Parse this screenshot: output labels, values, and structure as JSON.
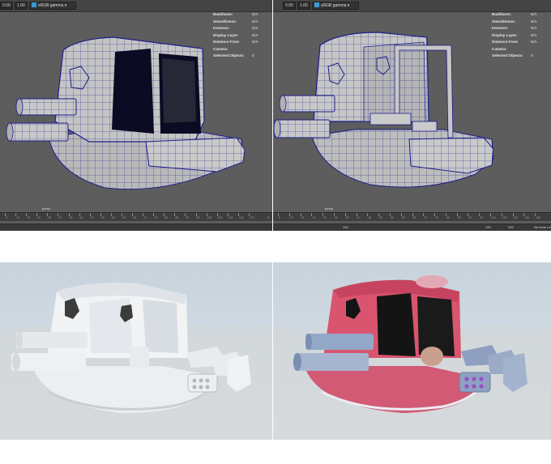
{
  "left_viewport": {
    "toolbar": {
      "v1": "0.00",
      "v2": "1.00",
      "color_space": "sRGB gamma"
    },
    "hud": [
      {
        "label": "Backfaces:",
        "value": "N/A"
      },
      {
        "label": "Smoothness:",
        "value": "N/A"
      },
      {
        "label": "Instance:",
        "value": "N/A"
      },
      {
        "label": "Display Layer:",
        "value": "N/A"
      },
      {
        "label": "Distance From Camera:",
        "value": "N/A"
      },
      {
        "label": "Selected Objects:",
        "value": "0"
      }
    ],
    "camera_label": "persp",
    "timeline_ticks": [
      "5",
      "10",
      "15",
      "20",
      "25",
      "30",
      "35",
      "40",
      "45",
      "50",
      "55",
      "60",
      "65",
      "70",
      "75",
      "80",
      "85",
      "90",
      "95",
      "100",
      "105",
      "110",
      "115",
      "120"
    ],
    "timeline_end": "1"
  },
  "right_viewport": {
    "toolbar": {
      "v1": "0.00",
      "v2": "1.00",
      "color_space": "sRGB gamma"
    },
    "hud": [
      {
        "label": "Backfaces:",
        "value": "N/A"
      },
      {
        "label": "Smoothness:",
        "value": "N/A"
      },
      {
        "label": "Instance:",
        "value": "N/A"
      },
      {
        "label": "Display Layer:",
        "value": "N/A"
      },
      {
        "label": "Distance From Camera:",
        "value": "N/A"
      },
      {
        "label": "Selected Objects:",
        "value": "0"
      }
    ],
    "camera_label": "persp",
    "timeline_ticks": [
      "5",
      "10",
      "15",
      "20",
      "25",
      "30",
      "35",
      "40",
      "45",
      "50",
      "55",
      "60",
      "65",
      "70",
      "75",
      "80",
      "85",
      "90",
      "95",
      "100",
      "105",
      "110",
      "115",
      "120"
    ],
    "range_bar": {
      "start": "120",
      "current": "120",
      "end": "200",
      "anim_layer": "No Anim La"
    }
  },
  "renders": {
    "left_material": "white clay",
    "right_material": "pink painted"
  },
  "colors": {
    "viewport_bg": "#5d5d5d",
    "wire": "#1d1d8c",
    "shell_gray": "#c8c8c8",
    "pink": "#d9546e",
    "metal_blue": "#8a9ec4"
  }
}
